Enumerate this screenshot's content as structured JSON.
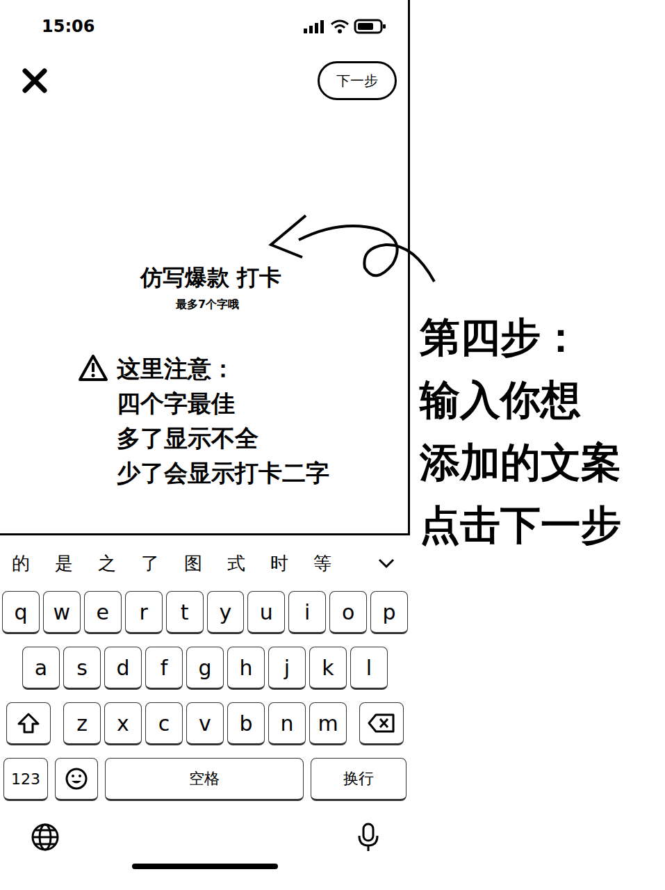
{
  "status_bar": {
    "time": "15:06"
  },
  "top_bar": {
    "next_button": "下一步"
  },
  "canvas": {
    "title": "仿写爆款 打卡",
    "hint": "最多7个字哦",
    "notice": [
      "这里注意：",
      "四个字最佳",
      "多了显示不全",
      "少了会显示打卡二字"
    ]
  },
  "keyboard": {
    "candidates": [
      "的",
      "是",
      "之",
      "了",
      "图",
      "式",
      "时",
      "等"
    ],
    "rows": [
      [
        "q",
        "w",
        "e",
        "r",
        "t",
        "y",
        "u",
        "i",
        "o",
        "p"
      ],
      [
        "a",
        "s",
        "d",
        "f",
        "g",
        "h",
        "j",
        "k",
        "l"
      ],
      [
        "z",
        "x",
        "c",
        "v",
        "b",
        "n",
        "m"
      ]
    ],
    "numbers_key": "123",
    "space_key": "空格",
    "return_key": "换行"
  },
  "annotation": {
    "lines": [
      "第四步：",
      "输入你想",
      "添加的文案",
      "点击下一步"
    ]
  }
}
